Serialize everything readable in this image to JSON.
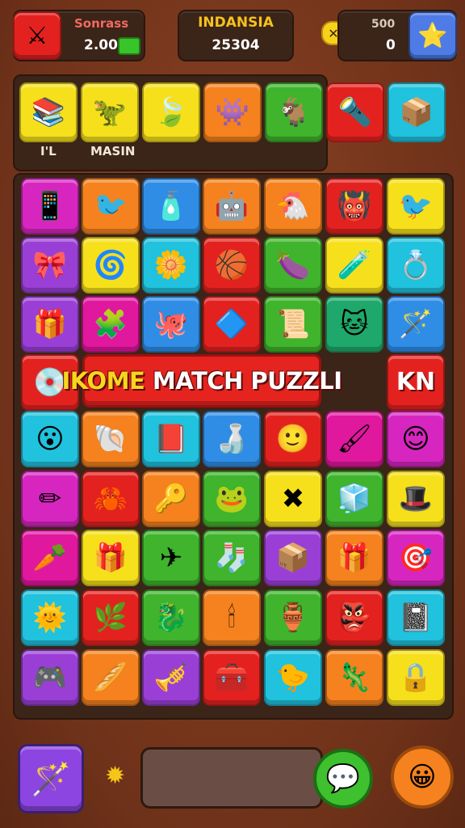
{
  "hud": {
    "left": {
      "label": "Sonrass",
      "value": "2.00",
      "icon": "sword-shield-icon",
      "label_color": "#f36a5f"
    },
    "middle": {
      "label": "INDANSIA",
      "value": "25304",
      "label_color": "#f6c21c"
    },
    "right": {
      "label": "500",
      "value": "0",
      "icon": "star-icon",
      "close_icon": "close-icon"
    }
  },
  "goal": {
    "label_left": "I'L",
    "label_right": "MASIN",
    "items": [
      {
        "icon": "books-icon",
        "glyph": "📚",
        "color": "yellow"
      },
      {
        "icon": "dinosaur-icon",
        "glyph": "🦖",
        "color": "yellow"
      },
      {
        "icon": "leaf-icon",
        "glyph": "🍃",
        "color": "yellow"
      },
      {
        "icon": "creature-icon",
        "glyph": "👾",
        "color": "orange"
      },
      {
        "icon": "goat-icon",
        "glyph": "🐐",
        "color": "green"
      },
      {
        "icon": "lamp-icon",
        "glyph": "🔦",
        "color": "red"
      },
      {
        "icon": "box-icon",
        "glyph": "📦",
        "color": "cyan"
      }
    ]
  },
  "banner": {
    "accent_text": "IKOME",
    "text": "MATCH PUZZLI",
    "side_text": "KN"
  },
  "board": {
    "rows": [
      [
        {
          "icon": "phone-icon",
          "glyph": "📱",
          "color": "pink"
        },
        {
          "icon": "bird-icon",
          "glyph": "🐦",
          "color": "orange"
        },
        {
          "icon": "jar-icon",
          "glyph": "🧴",
          "color": "blue"
        },
        {
          "icon": "robot-icon",
          "glyph": "🤖",
          "color": "orange"
        },
        {
          "icon": "chicken-icon",
          "glyph": "🐔",
          "color": "orange"
        },
        {
          "icon": "monster-icon",
          "glyph": "👹",
          "color": "red"
        },
        {
          "icon": "bird-red-icon",
          "glyph": "🐦",
          "color": "yellow"
        }
      ],
      [
        {
          "icon": "bow-icon",
          "glyph": "🎀",
          "color": "purple"
        },
        {
          "icon": "swirl-icon",
          "glyph": "🌀",
          "color": "yellow"
        },
        {
          "icon": "flower-icon",
          "glyph": "🌼",
          "color": "cyan"
        },
        {
          "icon": "ball-icon",
          "glyph": "🏀",
          "color": "red"
        },
        {
          "icon": "eggplant-icon",
          "glyph": "🍆",
          "color": "green"
        },
        {
          "icon": "potion-icon",
          "glyph": "🧪",
          "color": "yellow"
        },
        {
          "icon": "ring-icon",
          "glyph": "💍",
          "color": "cyan"
        }
      ],
      [
        {
          "icon": "gift-icon",
          "glyph": "🎁",
          "color": "purple"
        },
        {
          "icon": "puzzle-icon",
          "glyph": "🧩",
          "color": "magenta"
        },
        {
          "icon": "octopus-icon",
          "glyph": "🐙",
          "color": "blue"
        },
        {
          "icon": "arrows-icon",
          "glyph": "🔷",
          "color": "red"
        },
        {
          "icon": "scroll-icon",
          "glyph": "📜",
          "color": "green"
        },
        {
          "icon": "cat-icon",
          "glyph": "🐱",
          "color": "teal"
        },
        {
          "icon": "wand-icon",
          "glyph": "🪄",
          "color": "blue"
        }
      ],
      [
        {
          "icon": "disc-icon",
          "glyph": "💿",
          "color": "red"
        },
        null,
        null,
        null,
        null,
        null,
        {
          "icon": "kn-tile",
          "glyph": "",
          "color": "red"
        }
      ],
      [
        {
          "icon": "face-blue-icon",
          "glyph": "😮",
          "color": "cyan"
        },
        {
          "icon": "shell-icon",
          "glyph": "🐚",
          "color": "orange"
        },
        {
          "icon": "book-icon",
          "glyph": "📕",
          "color": "cyan"
        },
        {
          "icon": "bottle-icon",
          "glyph": "🍶",
          "color": "blue"
        },
        {
          "icon": "face-red-icon",
          "glyph": "🙂",
          "color": "red"
        },
        {
          "icon": "brush-icon",
          "glyph": "🖌",
          "color": "magenta"
        },
        {
          "icon": "smiley-icon",
          "glyph": "😊",
          "color": "pink"
        }
      ],
      [
        {
          "icon": "pencil-icon",
          "glyph": "✏",
          "color": "pink"
        },
        {
          "icon": "crab-icon",
          "glyph": "🦀",
          "color": "red"
        },
        {
          "icon": "key-icon",
          "glyph": "🔑",
          "color": "orange"
        },
        {
          "icon": "frog-icon",
          "glyph": "🐸",
          "color": "green"
        },
        {
          "icon": "cross-icon",
          "glyph": "✖",
          "color": "yellow"
        },
        {
          "icon": "cube-icon",
          "glyph": "🧊",
          "color": "green"
        },
        {
          "icon": "hat-icon",
          "glyph": "🎩",
          "color": "yellow"
        }
      ],
      [
        {
          "icon": "carrot-icon",
          "glyph": "🥕",
          "color": "magenta"
        },
        {
          "icon": "gift-bag-icon",
          "glyph": "🎁",
          "color": "yellow"
        },
        {
          "icon": "plane-icon",
          "glyph": "✈",
          "color": "green"
        },
        {
          "icon": "sock-icon",
          "glyph": "🧦",
          "color": "green"
        },
        {
          "icon": "crate-icon",
          "glyph": "📦",
          "color": "purple"
        },
        {
          "icon": "present-icon",
          "glyph": "🎁",
          "color": "orange"
        },
        {
          "icon": "target-icon",
          "glyph": "🎯",
          "color": "pink"
        }
      ],
      [
        {
          "icon": "sun-icon",
          "glyph": "🌞",
          "color": "cyan"
        },
        {
          "icon": "leaf-green-icon",
          "glyph": "🌿",
          "color": "red"
        },
        {
          "icon": "dragon-icon",
          "glyph": "🐉",
          "color": "green"
        },
        {
          "icon": "torch-icon",
          "glyph": "🕯",
          "color": "orange"
        },
        {
          "icon": "vase-icon",
          "glyph": "🏺",
          "color": "green"
        },
        {
          "icon": "mask-icon",
          "glyph": "👺",
          "color": "red"
        },
        {
          "icon": "notebook-icon",
          "glyph": "📓",
          "color": "cyan"
        }
      ],
      [
        {
          "icon": "gameboy-icon",
          "glyph": "🎮",
          "color": "purple"
        },
        {
          "icon": "bread-icon",
          "glyph": "🥖",
          "color": "orange"
        },
        {
          "icon": "trumpet-icon",
          "glyph": "🎺",
          "color": "purple"
        },
        {
          "icon": "chest-icon",
          "glyph": "🧰",
          "color": "red"
        },
        {
          "icon": "bird-yellow-icon",
          "glyph": "🐤",
          "color": "cyan"
        },
        {
          "icon": "lizard-icon",
          "glyph": "🦎",
          "color": "orange"
        },
        {
          "icon": "lock-icon",
          "glyph": "🔒",
          "color": "yellow"
        }
      ]
    ]
  },
  "bottom": {
    "left_icon": "magic-wand-icon",
    "left_glyph": "🪄",
    "gear_glyph": "✹",
    "middle_button_icon": "chat-bubble-icon",
    "middle_button_glyph": "💬",
    "right_button_icon": "face-icon",
    "right_button_glyph": "😀"
  }
}
